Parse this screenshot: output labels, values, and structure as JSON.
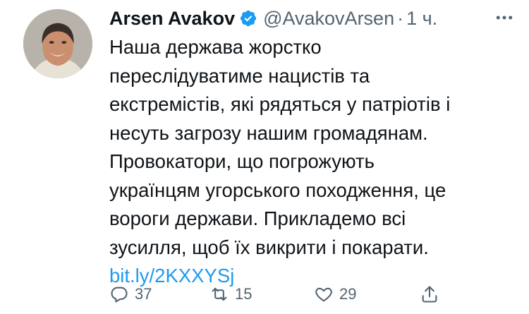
{
  "author": {
    "name": "Arsen Avakov",
    "handle": "@AvakovArsen",
    "separator": "·",
    "time": "1 ч."
  },
  "tweet": {
    "lines": [
      "Наша держава жорстко",
      "переслідуватиме нацистів та",
      "екстремістів, які рядяться у патріотів і",
      "несуть загрозу нашим громадянам.",
      "Провокатори, що погрожують",
      "українцям угорського походження, це",
      "вороги держави. Прикладемо всі",
      "зусилля, щоб їх викрити і покарати."
    ],
    "link": "bit.ly/2KXXYSj"
  },
  "actions": {
    "reply_count": "37",
    "retweet_count": "15",
    "like_count": "29"
  },
  "icons": {
    "verified": "verified-badge-icon",
    "more": "more-icon",
    "reply": "reply-icon",
    "retweet": "retweet-icon",
    "like": "heart-icon",
    "share": "share-icon"
  },
  "colors": {
    "text": "#0f1419",
    "secondary": "#536471",
    "accent": "#1d9bf0"
  }
}
